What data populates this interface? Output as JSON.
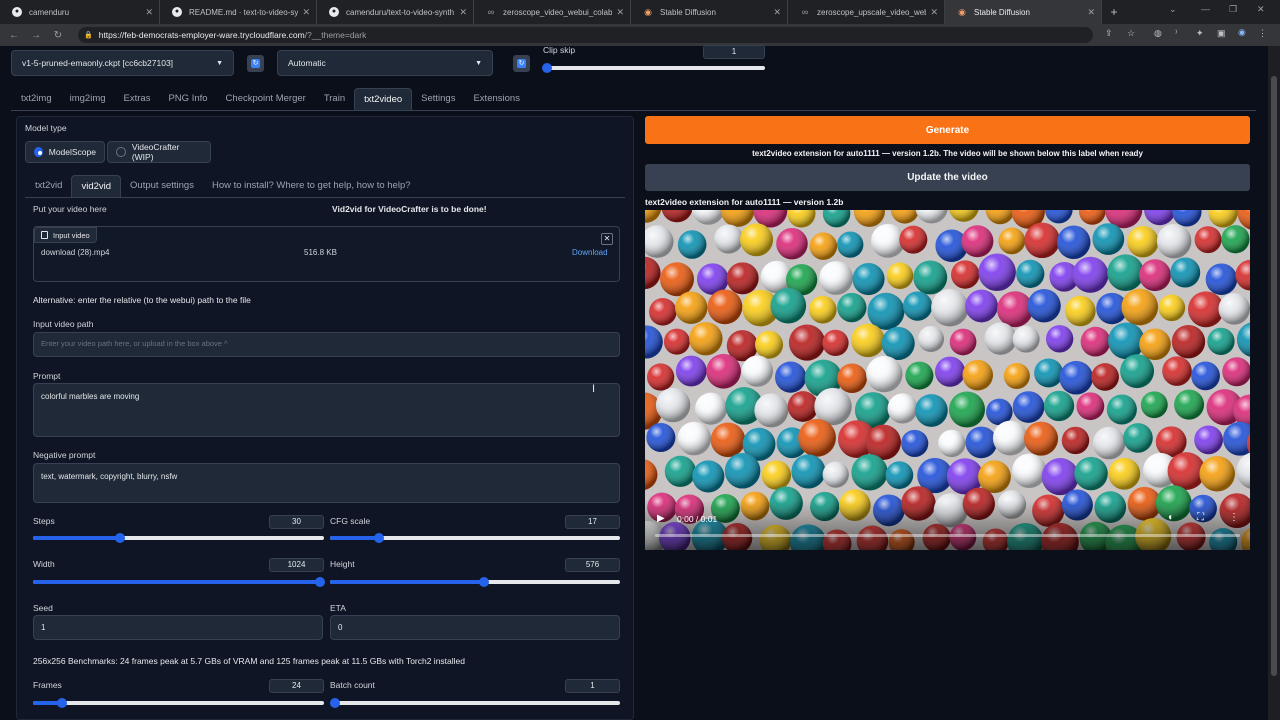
{
  "browser": {
    "tabs": [
      {
        "label": "camenduru",
        "icon": "github-icon"
      },
      {
        "label": "README.md · text-to-video-sy",
        "icon": "github-icon"
      },
      {
        "label": "camenduru/text-to-video-synth",
        "icon": "github-icon"
      },
      {
        "label": "zeroscope_video_webui_colab.ip",
        "icon": "colab-icon"
      },
      {
        "label": "Stable Diffusion",
        "icon": "stable-diffusion-icon"
      },
      {
        "label": "zeroscope_upscale_video_webui",
        "icon": "colab-icon"
      },
      {
        "label": "Stable Diffusion",
        "icon": "stable-diffusion-icon"
      }
    ],
    "new_tab": "+",
    "url_host": "https://feb-democrats-employer-ware.trycloudflare.com",
    "url_path": "/?__theme=dark"
  },
  "top": {
    "checkpoint": "v1-5-pruned-emaonly.ckpt [cc6cb27103]",
    "vae": "Automatic",
    "clip_skip_label": "Clip skip",
    "clip_skip_value": "1",
    "clip_skip_fraction": 0.0
  },
  "main_tabs": [
    "txt2img",
    "img2img",
    "Extras",
    "PNG Info",
    "Checkpoint Merger",
    "Train",
    "txt2video",
    "Settings",
    "Extensions"
  ],
  "active_main_tab": "txt2video",
  "left": {
    "model_type_label": "Model type",
    "model_options": [
      "ModelScope",
      "VideoCrafter (WIP)"
    ],
    "selected_model": "ModelScope",
    "sub_tabs": [
      "txt2vid",
      "vid2vid",
      "Output settings",
      "How to install? Where to get help, how to help?"
    ],
    "active_sub_tab": "vid2vid",
    "put_video_label": "Put your video here",
    "vid2vid_note": "Vid2vid for VideoCrafter is to be done!",
    "input_video_chip": "Input video",
    "file_name": "download (28).mp4",
    "file_size": "516.8 KB",
    "download_label": "Download",
    "alternative_label": "Alternative: enter the relative (to the webui) path to the file",
    "input_path_label": "Input video path",
    "input_path_placeholder": "Enter your video path here, or upload in the box above ^",
    "prompt_label": "Prompt",
    "prompt_value": "colorful marbles are moving",
    "negative_label": "Negative prompt",
    "negative_value": "text, watermark, copyright, blurry, nsfw",
    "steps_label": "Steps",
    "steps_value": "30",
    "steps_fraction": 0.3,
    "cfg_label": "CFG scale",
    "cfg_value": "17",
    "cfg_fraction": 0.17,
    "width_label": "Width",
    "width_value": "1024",
    "width_fraction": 1.0,
    "height_label": "Height",
    "height_value": "576",
    "height_fraction": 0.53,
    "seed_label": "Seed",
    "seed_value": "1",
    "eta_label": "ETA",
    "eta_value": "0",
    "benchmark": "256x256 Benchmarks: 24 frames peak at 5.7 GBs of VRAM and 125 frames peak at 11.5 GBs with Torch2 installed",
    "frames_label": "Frames",
    "frames_value": "24",
    "frames_fraction": 0.1,
    "batch_label": "Batch count",
    "batch_value": "1",
    "batch_fraction": 0.0
  },
  "right": {
    "generate_label": "Generate",
    "status_line": "text2video extension for auto1111 — version 1.2b. The video will be shown below this label when ready",
    "update_label": "Update the video",
    "video_title": "text2video extension for auto1111 — version 1.2b",
    "video_time": "0:00 / 0:01"
  },
  "colors": {
    "accent": "#2563eb",
    "generate": "#f97316",
    "background": "#0b0f19"
  }
}
